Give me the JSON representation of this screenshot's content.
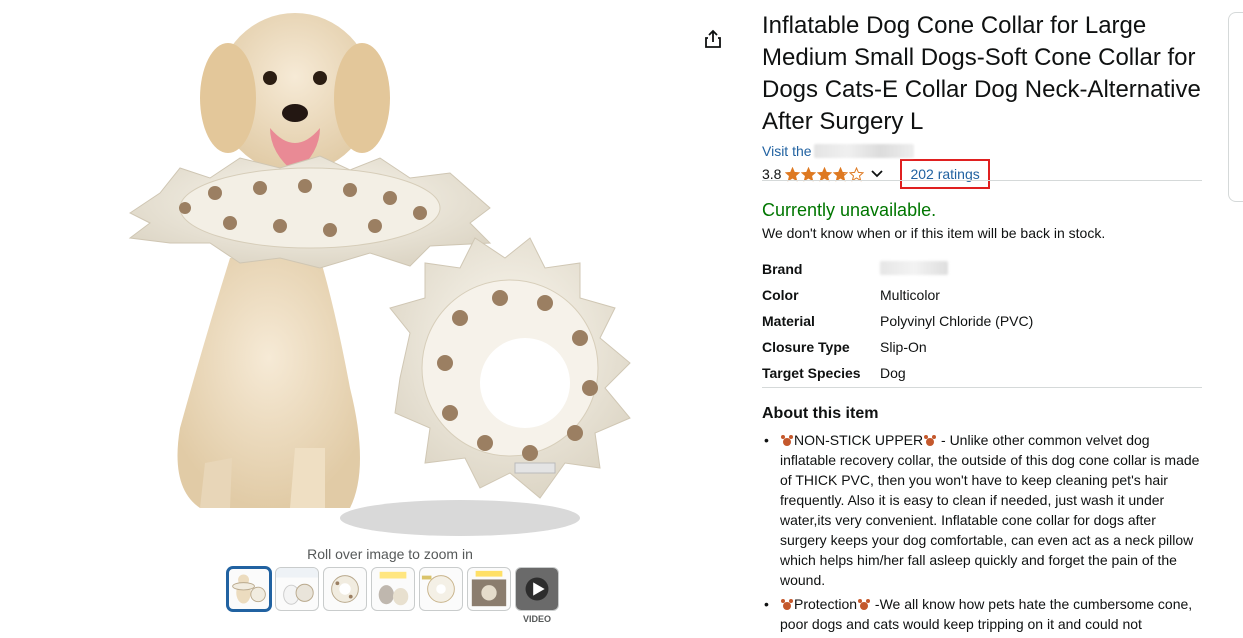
{
  "product": {
    "title": "Inflatable Dog Cone Collar for Large Medium Small Dogs-Soft Cone Collar for Dogs Cats-E Collar Dog Neck-Alternative After Surgery L",
    "store_prefix": "Visit the",
    "rating_value": "3.8",
    "rating_stars": 3.8,
    "ratings_count": "202 ratings",
    "availability": "Currently unavailable.",
    "availability_note": "We don't know when or if this item will be back in stock."
  },
  "specs": [
    {
      "key": "Brand",
      "value": ""
    },
    {
      "key": "Color",
      "value": "Multicolor"
    },
    {
      "key": "Material",
      "value": "Polyvinyl Chloride (PVC)"
    },
    {
      "key": "Closure Type",
      "value": "Slip-On"
    },
    {
      "key": "Target Species",
      "value": "Dog"
    }
  ],
  "about": {
    "heading": "About this item",
    "bullets": [
      {
        "lead": "NON-STICK UPPER",
        "text": " - Unlike other common velvet dog inflatable recovery collar, the outside of this dog cone collar is made of THICK PVC, then you won't have to keep cleaning pet's hair frequently. Also it is easy to clean if needed, just wash it under water,its very convenient. Inflatable cone collar for dogs after surgery keeps your dog comfortable, can even act as a neck pillow which helps him/her fall asleep quickly and forget the pain of the wound."
      },
      {
        "lead": "Protection",
        "text": " -We all know how pets hate the cumbersome cone, poor dogs and cats would keep tripping on it and could not"
      }
    ]
  },
  "gallery": {
    "zoom_hint": "Roll over image to zoom in",
    "video_label": "VIDEO",
    "thumbnail_count": 7,
    "selected_index": 0
  },
  "colors": {
    "link": "#2162a1",
    "available": "#007600",
    "star": "#de7921",
    "highlight": "#e02020"
  },
  "icons": {
    "share": "share-icon",
    "chevron": "chevron-down-icon",
    "star": "star-icon"
  }
}
